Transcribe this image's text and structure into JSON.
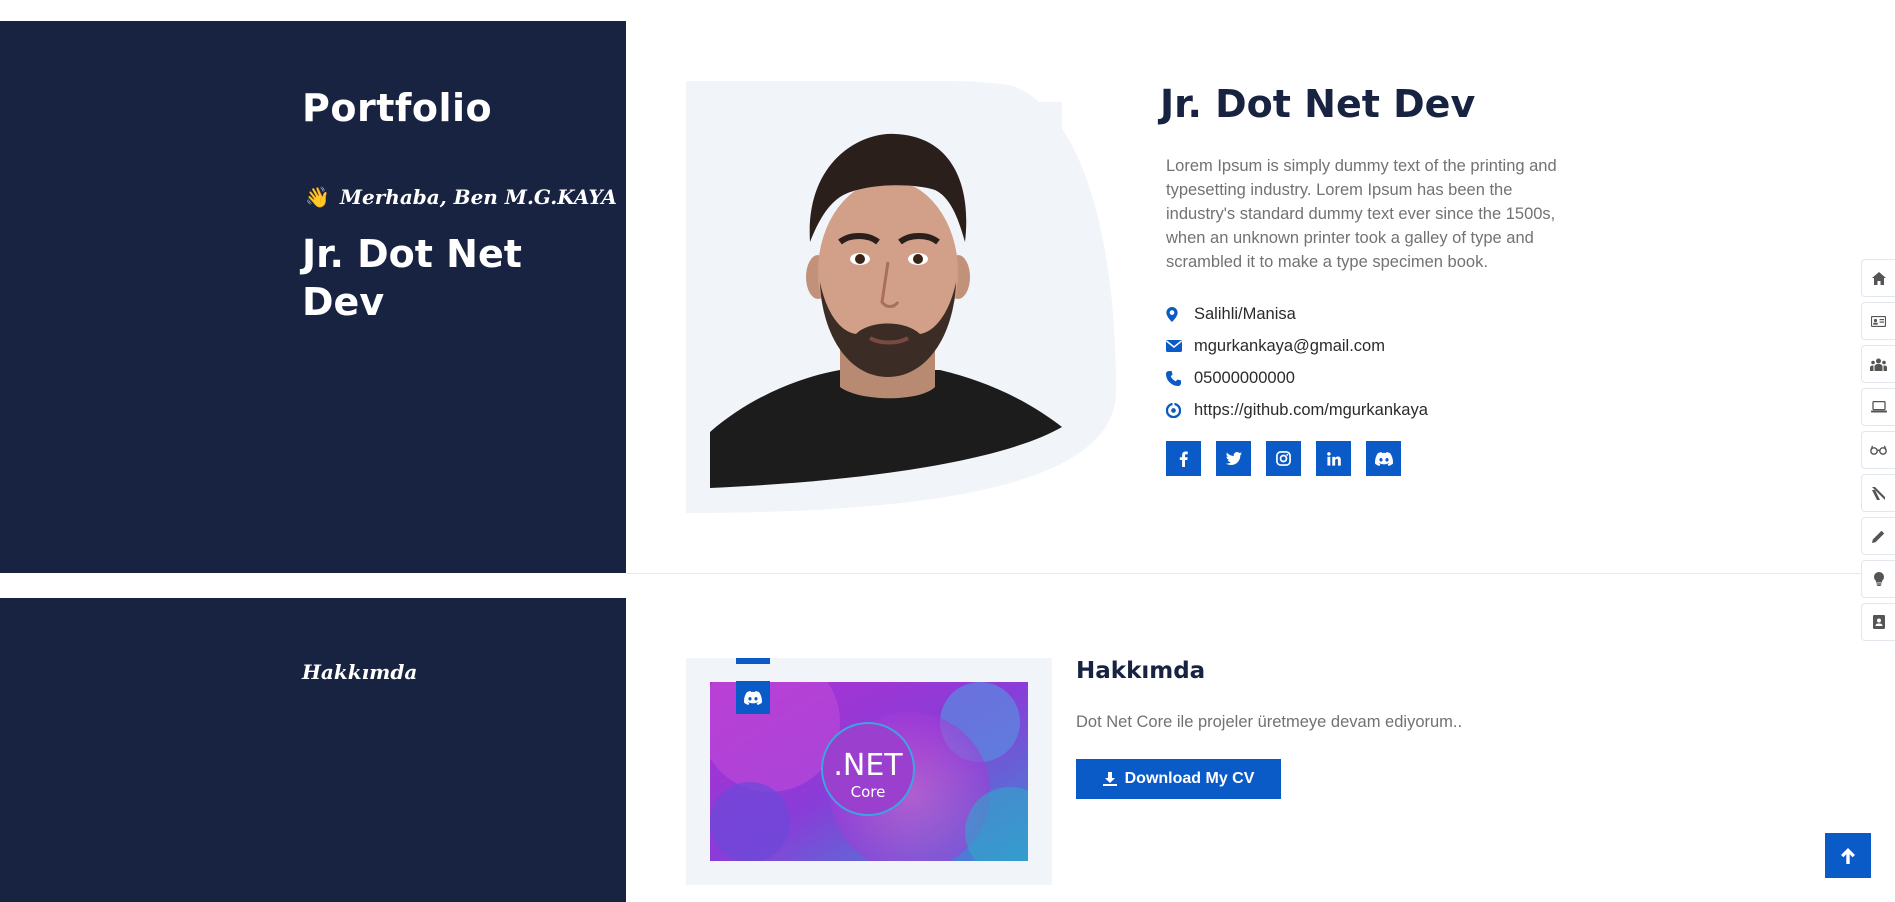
{
  "brand": "Portfolio",
  "hero": {
    "greeting_icon": "waving-hand",
    "greeting_emoji": "👋",
    "greeting": "Merhaba, Ben M.G.KAYA",
    "left_title": "Jr. Dot Net Dev",
    "title": "Jr. Dot Net Dev",
    "description": "Lorem Ipsum is simply dummy text of the printing and typesetting industry. Lorem Ipsum has been the industry's standard dummy text ever since the 1500s, when an unknown printer took a galley of type and scrambled it to make a type specimen book.",
    "info": [
      {
        "icon": "map-marker-icon",
        "text": "Salihli/Manisa"
      },
      {
        "icon": "envelope-icon",
        "text": "mgurkankaya@gmail.com"
      },
      {
        "icon": "phone-icon",
        "text": "05000000000"
      },
      {
        "icon": "github-icon",
        "text": "https://github.com/mgurkankaya"
      }
    ],
    "socials": [
      "facebook-icon",
      "twitter-icon",
      "instagram-icon",
      "linkedin-icon",
      "discord-icon"
    ]
  },
  "side_nav": [
    "home-icon",
    "id-card-icon",
    "users-icon",
    "laptop-icon",
    "glasses-icon",
    "blog-icon",
    "pencil-icon",
    "lightbulb-icon",
    "contact-book-icon"
  ],
  "about": {
    "label": "Hakkımda",
    "title": "Hakkımda",
    "text": "Dot Net Core ile projeler üretmeye devam ediyorum..",
    "image_text_main": ".NET",
    "image_text_sub": "Core",
    "cv_button": "Download My CV"
  },
  "colors": {
    "navy": "#172340",
    "accent": "#0a5bc7",
    "light_bg": "#f1f4f9"
  }
}
